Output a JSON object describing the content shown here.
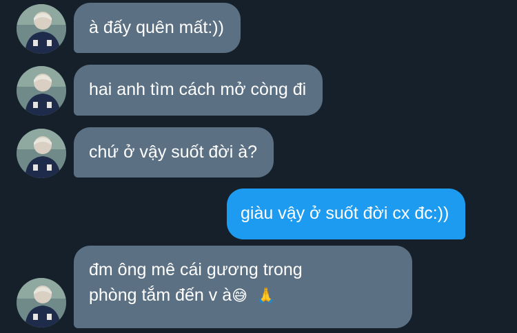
{
  "theme": {
    "background": "#15202b",
    "incoming_bubble": "#5b7083",
    "outgoing_bubble": "#1d9bf0",
    "text": "#ffffff"
  },
  "messages": [
    {
      "direction": "incoming",
      "lines": [
        "à đấy quên mất:))"
      ]
    },
    {
      "direction": "incoming",
      "lines": [
        "hai anh tìm cách mở còng đi"
      ]
    },
    {
      "direction": "incoming",
      "lines": [
        "chứ ở vậy suốt đời à?"
      ]
    },
    {
      "direction": "outgoing",
      "lines": [
        "giàu vậy ở suốt đời cx đc:))"
      ]
    },
    {
      "direction": "incoming",
      "lines": [
        "đm ông mê cái gương trong",
        "phòng tắm đến v à"
      ],
      "emojis": [
        "😅",
        "🙏"
      ]
    }
  ]
}
